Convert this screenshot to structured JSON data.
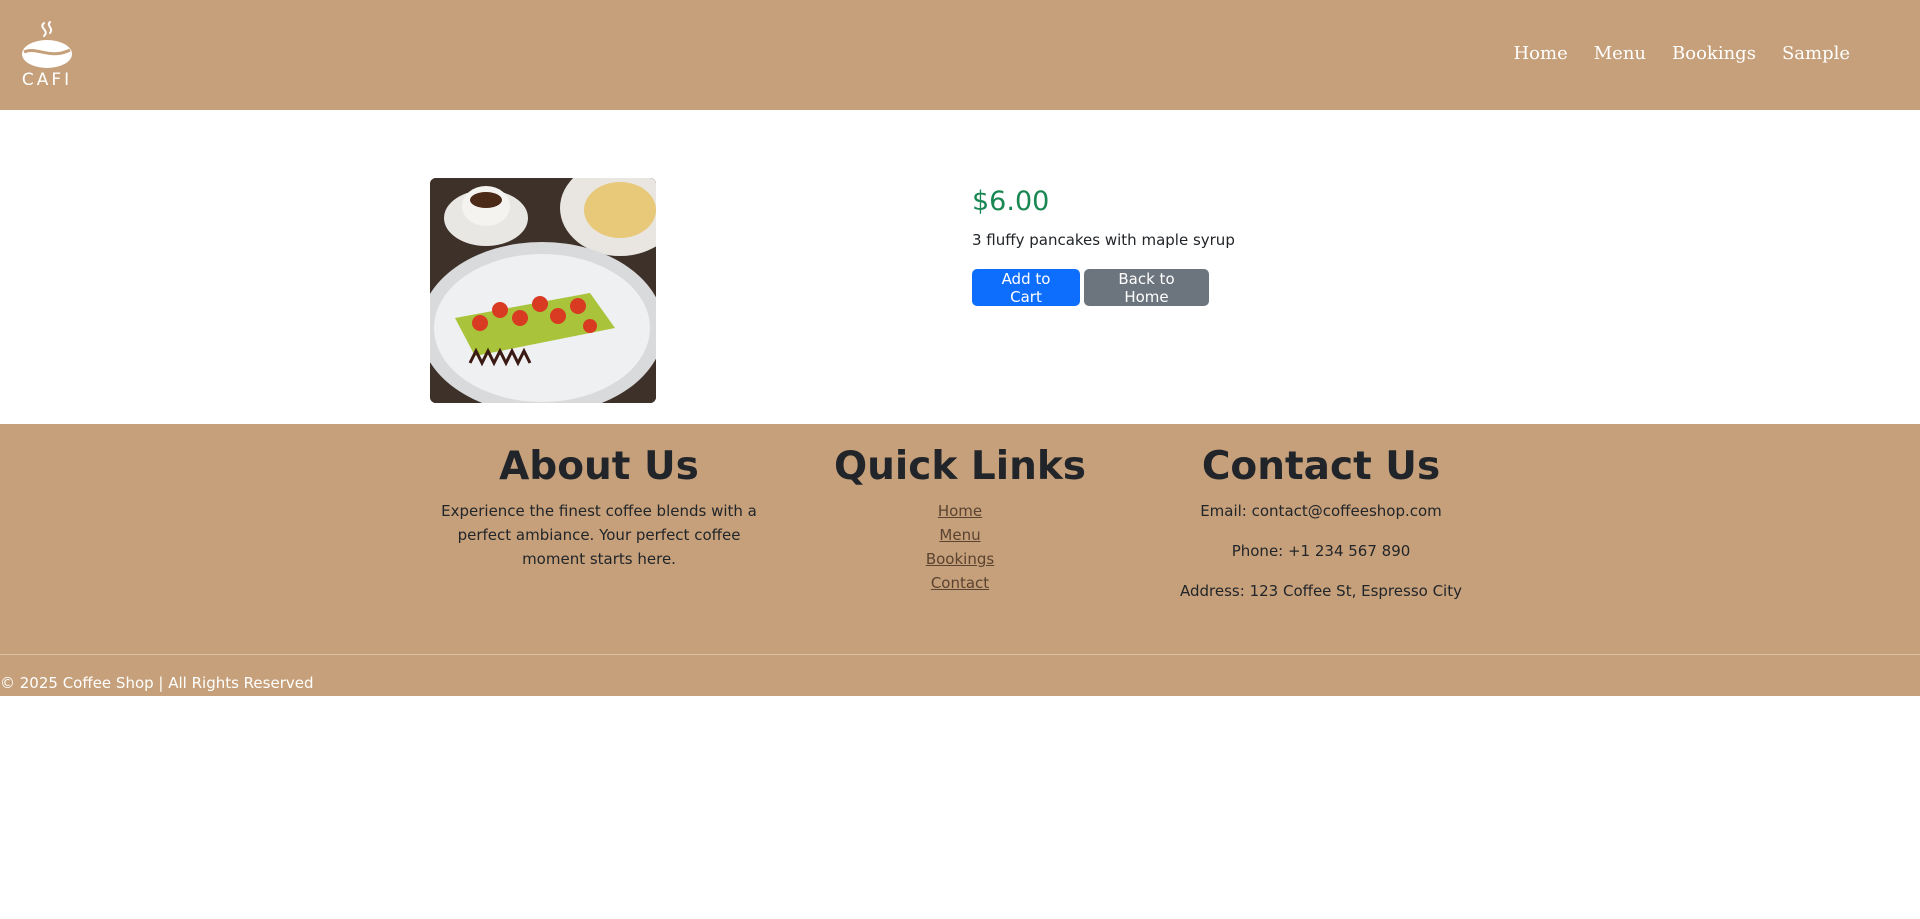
{
  "header": {
    "logo_text": "CAFI",
    "nav": [
      {
        "label": "Home"
      },
      {
        "label": "Menu"
      },
      {
        "label": "Bookings"
      },
      {
        "label": "Sample"
      }
    ]
  },
  "product": {
    "price": "$6.00",
    "description": "3 fluffy pancakes with maple syrup",
    "add_to_cart_label": "Add to Cart",
    "back_home_label": "Back to Home"
  },
  "footer": {
    "about": {
      "title": "About Us",
      "text": "Experience the finest coffee blends with a perfect ambiance. Your perfect coffee moment starts here."
    },
    "quick_links": {
      "title": "Quick Links",
      "links": [
        "Home",
        "Menu",
        "Bookings",
        "Contact"
      ]
    },
    "contact": {
      "title": "Contact Us",
      "email": "Email: contact@coffeeshop.com",
      "phone": "Phone: +1 234 567 890",
      "address": "Address: 123 Coffee St, Espresso City"
    },
    "copyright": "© 2025 Coffee Shop | All Rights Reserved"
  },
  "colors": {
    "header_bg": "#c6a07a",
    "price": "#198754",
    "primary": "#0d6efd",
    "secondary": "#6c757d"
  },
  "icons": {
    "logo": "coffee-bean-steam-icon"
  }
}
